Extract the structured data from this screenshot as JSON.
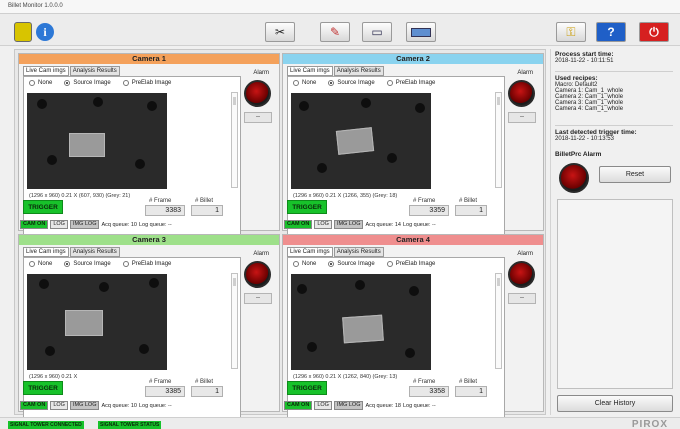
{
  "window": {
    "title": "Billet Monitor 1.0.0.0"
  },
  "toolbar": {
    "icons": [
      "logo-icon",
      "info-icon",
      "tools-icon",
      "eraser-icon",
      "monitor-icon",
      "keyboard-icon",
      "lock-icon",
      "help-icon",
      "power-icon"
    ],
    "help_label": "?"
  },
  "cameras": [
    {
      "title": "Camera 1",
      "header_color": "#f4a15b",
      "tabs": [
        "Live Cam imgs",
        "Analysis Results"
      ],
      "radios": [
        "None",
        "Source Image",
        "PreElab Image"
      ],
      "selected": "Source Image",
      "img_info": "(1296 x 960)   0.21 X  (607, 930)  (Grey: 21)",
      "alarm_label": "Alarm",
      "alarm_value": "--",
      "trigger": "TRIGGER",
      "frame_label": "# Frame",
      "frame": "3383",
      "billet_label": "# Billet",
      "billet": "1",
      "status": {
        "cam_on": "CAM ON",
        "log": "LOG",
        "img_log": "IMG LOG",
        "acq_queue": "Acq queue: 10",
        "log_queue": "Log queue: --"
      }
    },
    {
      "title": "Camera 2",
      "header_color": "#8ad3ef",
      "tabs": [
        "Live Cam imgs",
        "Analysis Results"
      ],
      "radios": [
        "None",
        "Source Image",
        "PreElab Image"
      ],
      "selected": "Source Image",
      "img_info": "(1296 x 960)   0.21 X  (1266, 355)  (Grey: 18)",
      "alarm_label": "Alarm",
      "alarm_value": "--",
      "trigger": "TRIGGER",
      "frame_label": "# Frame",
      "frame": "3359",
      "billet_label": "# Billet",
      "billet": "1",
      "status": {
        "cam_on": "CAM ON",
        "log": "LOG",
        "img_log": "IMG LOG",
        "acq_queue": "Acq queue: 14",
        "log_queue": "Log queue: --"
      }
    },
    {
      "title": "Camera 3",
      "header_color": "#9ee08a",
      "tabs": [
        "Live Cam imgs",
        "Analysis Results"
      ],
      "radios": [
        "None",
        "Source Image",
        "PreElab Image"
      ],
      "selected": "Source Image",
      "img_info": "(1296 x 960)   0.21 X",
      "alarm_label": "Alarm",
      "alarm_value": "--",
      "trigger": "TRIGGER",
      "frame_label": "# Frame",
      "frame": "3385",
      "billet_label": "# Billet",
      "billet": "1",
      "status": {
        "cam_on": "CAM ON",
        "log": "LOG",
        "img_log": "IMG LOG",
        "acq_queue": "Acq queue: 10",
        "log_queue": "Log queue: --"
      }
    },
    {
      "title": "Camera 4",
      "header_color": "#ef8e8e",
      "tabs": [
        "Live Cam imgs",
        "Analysis Results"
      ],
      "radios": [
        "None",
        "Source Image",
        "PreElab Image"
      ],
      "selected": "Source Image",
      "img_info": "(1296 x 960)   0.21 X  (1262, 840)  (Grey: 13)",
      "alarm_label": "Alarm",
      "alarm_value": "--",
      "trigger": "TRIGGER",
      "frame_label": "# Frame",
      "frame": "3358",
      "billet_label": "# Billet",
      "billet": "1",
      "status": {
        "cam_on": "CAM ON",
        "log": "LOG",
        "img_log": "IMG LOG",
        "acq_queue": "Acq queue: 18",
        "log_queue": "Log queue: --"
      }
    }
  ],
  "side": {
    "start_label": "Process start time:",
    "start_time": "2018-11-22 - 10:11:51",
    "recipes_label": "Used recipes:",
    "recipes": [
      "Macro: Default2",
      "Camera 1: Cam_1_whole",
      "Camera 2: Cam_1_whole",
      "Camera 3: Cam_1_whole",
      "Camera 4: Cam_1_whole"
    ],
    "trigger_label": "Last detected trigger time:",
    "trigger_time": "2018-11-22 - 10:13:53",
    "alarm_label": "BilletPrc Alarm",
    "reset": "Reset",
    "clear_history": "Clear History"
  },
  "bottom": {
    "signal1": "SIGNAL TOWER CONNECTED",
    "signal2": "SIGNAL TOWER STATUS",
    "brand": "PIROX"
  }
}
